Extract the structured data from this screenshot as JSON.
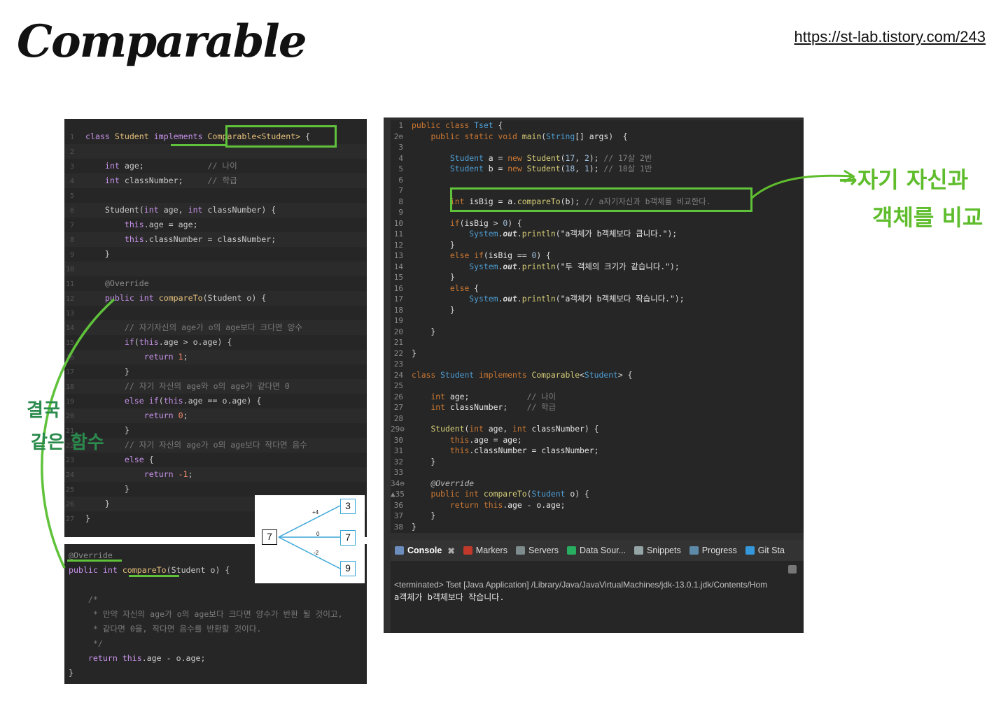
{
  "slide": {
    "title": "Comparable",
    "url": "https://st-lab.tistory.com/243"
  },
  "annotations": {
    "right_line1": "→자기 자신과",
    "right_line2": "객체를 비교",
    "left_line1": "결국",
    "left_line2": "같은 함수"
  },
  "diagram": {
    "source": "7",
    "targets": [
      "3",
      "7",
      "9"
    ],
    "labels": [
      "+4",
      "0",
      "-2"
    ]
  },
  "console": {
    "tabs": [
      "Console",
      "Markers",
      "Servers",
      "Data Sour...",
      "Snippets",
      "Progress",
      "Git Sta"
    ],
    "terminated": "<terminated> Tset [Java Application] /Library/Java/JavaVirtualMachines/jdk-13.0.1.jdk/Contents/Hom",
    "output": "a객체가 b객체보다 작습니다."
  },
  "colors": {
    "highlight": "#5fc23a",
    "annotation_green": "#5fbd2d",
    "annotation_teal": "#2b8a4d"
  }
}
